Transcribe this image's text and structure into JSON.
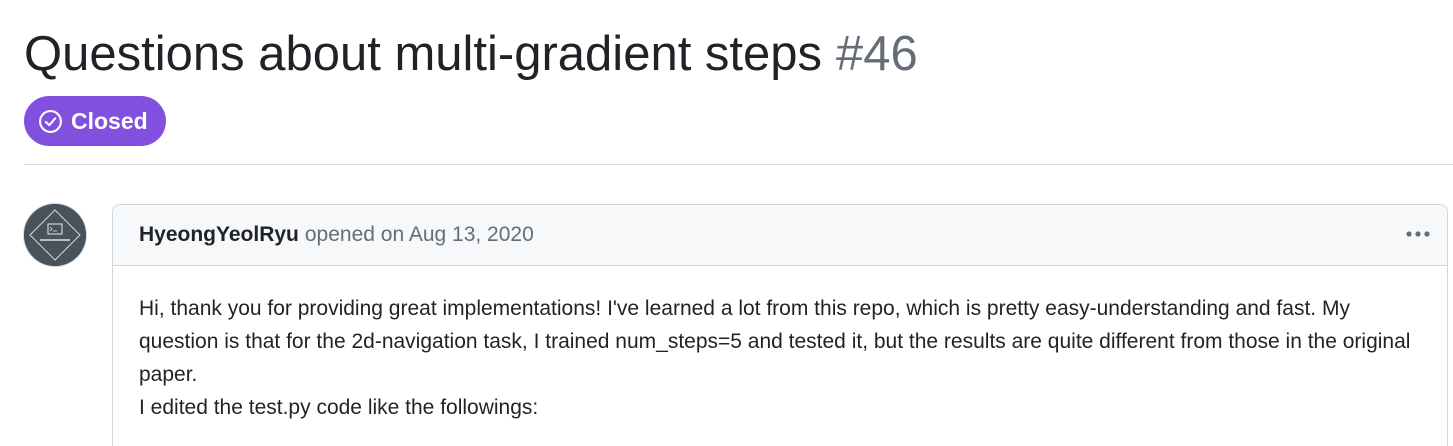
{
  "issue": {
    "title": "Questions about multi-gradient steps",
    "number": "#46",
    "state": "Closed",
    "state_color": "#8250df"
  },
  "comment": {
    "author": "HyeongYeolRyu",
    "action": "opened on Aug 13, 2020",
    "avatar_icon": "terminal-avatar-icon",
    "more_icon": "kebab-horizontal-icon",
    "body": [
      "Hi, thank you for providing great implementations! I've learned a lot from this repo, which is pretty easy-understanding and fast. My question is that for the 2d-navigation task, I trained num_steps=5 and tested it, but the results are quite different from those in the original paper.",
      "I edited the test.py code like the followings:"
    ]
  }
}
